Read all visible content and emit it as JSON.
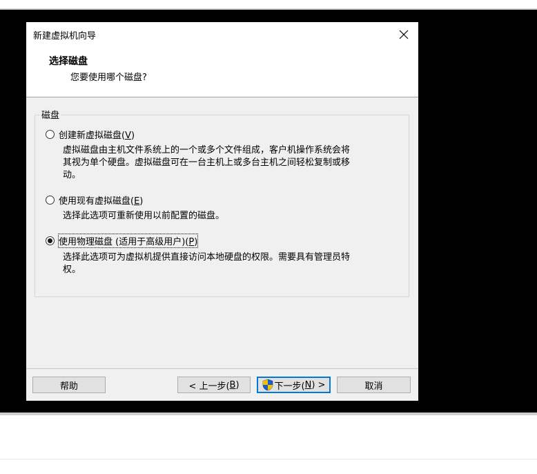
{
  "dialog": {
    "title": "新建虚拟机向导",
    "heading": "选择磁盘",
    "subheading": "您要使用哪个磁盘?"
  },
  "group": {
    "legend": "磁盘",
    "options": [
      {
        "label_prefix": "创建新虚拟磁盘(",
        "mnemonic": "V",
        "label_suffix": ")",
        "checked": false,
        "description_lines": [
          "虚拟磁盘由主机文件系统上的一个或多个文件组成，客户机操作系统会将",
          "其视为单个硬盘。虚拟磁盘可在一台主机上或多台主机之间轻松复制或移",
          "动。"
        ]
      },
      {
        "label_prefix": "使用现有虚拟磁盘(",
        "mnemonic": "E",
        "label_suffix": ")",
        "checked": false,
        "description_lines": [
          "选择此选项可重新使用以前配置的磁盘。"
        ]
      },
      {
        "label_prefix": "使用物理磁盘 (适用于高级用户)(",
        "mnemonic": "P",
        "label_suffix": ")",
        "checked": true,
        "description_lines": [
          "选择此选项可为虚拟机提供直接访问本地硬盘的权限。需要具有管理员特",
          "权。"
        ]
      }
    ]
  },
  "buttons": {
    "help": "帮助",
    "back_prefix": "< 上一步(",
    "back_mnemonic": "B",
    "back_suffix": ")",
    "next_prefix": "下一步(",
    "next_mnemonic": "N",
    "next_suffix": ") >",
    "cancel": "取消"
  },
  "icons": {
    "close": "close-icon",
    "shield": "uac-shield-icon"
  },
  "colors": {
    "backdrop": "#000000",
    "dialog_bg": "#f0f0f0",
    "header_bg": "#ffffff",
    "default_button_border": "#0078d7",
    "shield_blue": "#1e5fbf",
    "shield_yellow": "#f2c200"
  }
}
